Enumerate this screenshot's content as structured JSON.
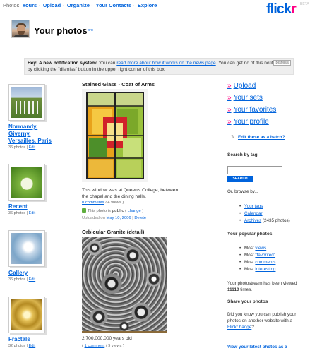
{
  "nav": {
    "prefix": "Photos:",
    "items": [
      "Yours",
      "Upload",
      "Organize",
      "Your Contacts",
      "Explore"
    ]
  },
  "logo": {
    "text": "flickr",
    "suffix": "BETA"
  },
  "header": {
    "title": "Your photos",
    "pro": "pro"
  },
  "notification": {
    "bold": "Hey! A new notification system!",
    "text1": " You can ",
    "link": "read more about how it works on the news page",
    "text2": ". You can get rid of this notification by clicking the \"dismiss\" button in the upper right corner of this box.",
    "dismiss": "DISMISS"
  },
  "sets": [
    {
      "title_l1": "Normandy,",
      "title_l2": "Giverny,",
      "title_l3": "Versailles, Paris",
      "count": "36 photos",
      "edit": "Edit"
    },
    {
      "title_l1": "Recent",
      "count": "36 photos",
      "edit": "Edit"
    },
    {
      "title_l1": "Gallery",
      "count": "36 photos",
      "edit": "Edit"
    },
    {
      "title_l1": "Fractals",
      "count": "32 photos",
      "edit": "Edit"
    }
  ],
  "photos": [
    {
      "title": "Stained Glass - Coat of Arms",
      "caption": "This window was at Queen's College, between the chapel and the dining halls.",
      "comments": "0 comments",
      "views": "4 views",
      "public_prefix": "This photo is ",
      "public_word": "public",
      "change": "change",
      "uploaded_prefix": "Uploaded on ",
      "uploaded_date": "May 10, 2006",
      "delete": "Delete"
    },
    {
      "title": "Orbicular Granite (detail)",
      "caption": "2,700,000,000 years old",
      "comments": "1 comment",
      "views": "9 views"
    }
  ],
  "sidebar": {
    "links": [
      "Upload",
      "Your sets",
      "Your favorites",
      "Your profile"
    ],
    "edit_batch": "Edit these as a batch?",
    "search_by_tag": "Search by tag",
    "search_button": "SEARCH",
    "browse": "Or, browse by...",
    "tags": "Your tags",
    "calendar": "Calendar",
    "archives": "Archives",
    "archives_count": " (2435 photos)",
    "popular_head": "Your popular photos",
    "most": "Most ",
    "popular": [
      "views",
      "\"favorited\"",
      "comments",
      "interesting"
    ],
    "viewed_l1": "Your photostream has been viewed",
    "viewed_count": "11110",
    "viewed_suffix": " times.",
    "share_head": "Share your photos",
    "share_l1": "Did you know you can publish your",
    "share_l2": "photos on another website with a",
    "badge": "Flickr badge",
    "badge_suffix": "?",
    "latest": "View your latest photos as a"
  },
  "colors": {
    "link": "#0063dc",
    "pink": "#ff0084",
    "public_icon": "#5fae3e"
  }
}
